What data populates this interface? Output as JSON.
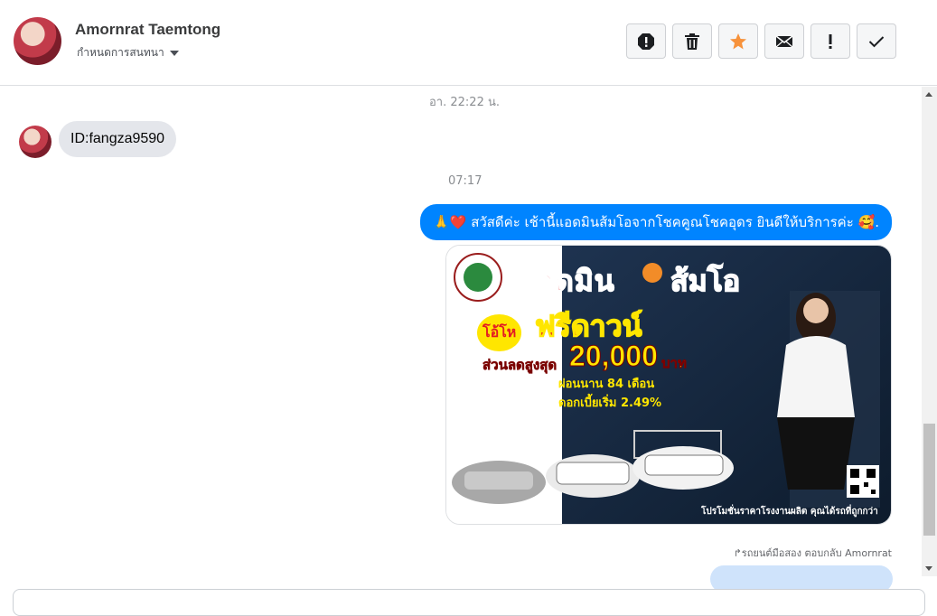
{
  "header": {
    "contact_name": "Amornrat Taemtong",
    "conversation_label": "กำหนดการสนทนา",
    "actions": [
      {
        "name": "report-icon",
        "label": "report"
      },
      {
        "name": "trash-icon",
        "label": "delete"
      },
      {
        "name": "star-icon",
        "label": "star",
        "color": "#f7923b"
      },
      {
        "name": "envelope-icon",
        "label": "mark-unread"
      },
      {
        "name": "exclamation-icon",
        "label": "important"
      },
      {
        "name": "check-icon",
        "label": "done"
      }
    ]
  },
  "messages": {
    "timestamp_1": "อา. 22:22 น.",
    "incoming_text": "ID:fangza9590",
    "timestamp_2": "07:17",
    "outgoing_text": "🙏❤️ สวัสดีค่ะ เช้านี้แอดมินส้มโอจากโชคคูณโชคอุดร ยินดีให้บริการค่ะ 🥰.",
    "reply_line": "↱รถยนต์มือสอง ตอบกลับ Amornrat"
  },
  "promo_image": {
    "headline_1": "แอดมิน",
    "headline_2": "ส้มโอ",
    "badge": "โอ้โห",
    "offer": "ฟรีดาวน์",
    "discount_label": "ส่วนลดสูงสุด",
    "discount_amount": "20,000",
    "discount_unit": "บาท",
    "installment": "ผ่อนนาน 84 เดือน",
    "interest": "ดอกเบี้ยเริ่ม 2.49%",
    "footer": "โปรโมชั่นราคาโรงงานผลิต คุณได้รถที่ถูกกว่า"
  },
  "colors": {
    "outgoing_bubble": "#0084ff",
    "incoming_bubble": "#e4e6eb",
    "star": "#f7923b"
  }
}
